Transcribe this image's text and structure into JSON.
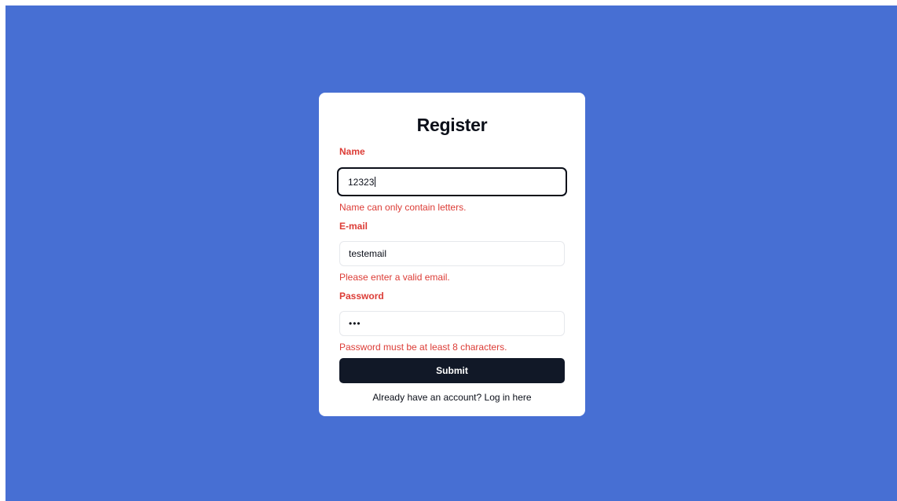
{
  "colors": {
    "background": "#476fd3",
    "card": "#ffffff",
    "error": "#dc3c36",
    "button": "#111827",
    "text": "#0b0f19"
  },
  "form": {
    "title": "Register",
    "name": {
      "label": "Name",
      "value": "12323",
      "error": "Name can only contain letters."
    },
    "email": {
      "label": "E-mail",
      "value": "testemail",
      "error": "Please enter a valid email."
    },
    "password": {
      "label": "Password",
      "masked_value": "•••",
      "error": "Password must be at least 8 characters."
    },
    "submit_label": "Submit",
    "footer": {
      "prefix": "Already have an account? ",
      "link_label": "Log in here"
    }
  }
}
